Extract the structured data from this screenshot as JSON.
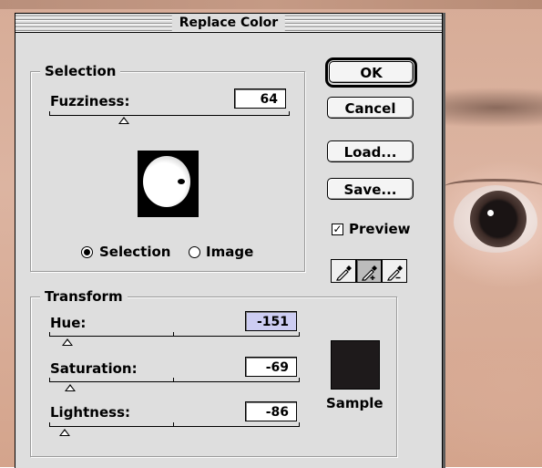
{
  "dialog": {
    "title": "Replace Color"
  },
  "selection": {
    "legend": "Selection",
    "fuzziness_label": "Fuzziness:",
    "fuzziness_value": "64",
    "fuzziness_fraction": 0.32,
    "radio_selection": "Selection",
    "radio_image": "Image",
    "selected_mode": "selection"
  },
  "buttons": {
    "ok": "OK",
    "cancel": "Cancel",
    "load": "Load...",
    "save": "Save..."
  },
  "preview": {
    "label": "Preview",
    "checked": true
  },
  "tools": [
    {
      "name": "eyedropper-icon",
      "active": false
    },
    {
      "name": "eyedropper-plus-icon",
      "active": true
    },
    {
      "name": "eyedropper-minus-icon",
      "active": false
    }
  ],
  "transform": {
    "legend": "Transform",
    "hue_label": "Hue:",
    "hue_value": "-151",
    "saturation_label": "Saturation:",
    "saturation_value": "-69",
    "lightness_label": "Lightness:",
    "lightness_value": "-86",
    "sample_label": "Sample",
    "sample_color": "#1e1a1b"
  }
}
